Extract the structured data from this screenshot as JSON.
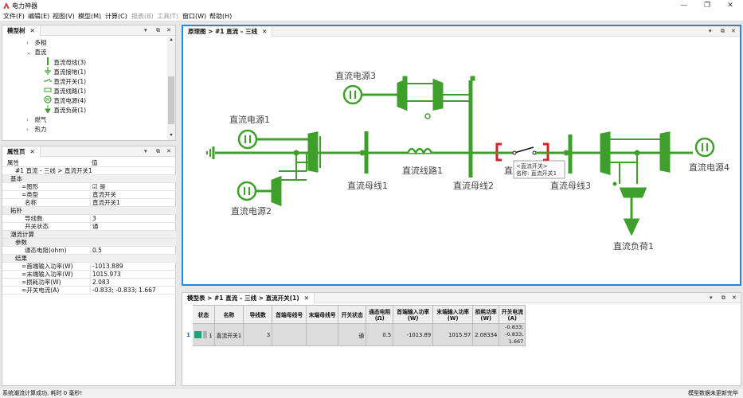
{
  "window": {
    "title": "电力神器",
    "controls": [
      "—",
      "❐",
      "✕"
    ]
  },
  "menu": [
    {
      "label": "文件(F)",
      "enabled": true
    },
    {
      "label": "编辑(E)",
      "enabled": true
    },
    {
      "label": "视图(V)",
      "enabled": true
    },
    {
      "label": "模型(M)",
      "enabled": true
    },
    {
      "label": "计算(C)",
      "enabled": true
    },
    {
      "label": "报表(B)",
      "enabled": false
    },
    {
      "label": "工具(T)",
      "enabled": false
    },
    {
      "label": "窗口(W)",
      "enabled": true
    },
    {
      "label": "帮助(H)",
      "enabled": true
    }
  ],
  "model_tree": {
    "tab": "模型树",
    "items": [
      {
        "label": "多相",
        "arrow": "›"
      },
      {
        "label": "直流",
        "arrow": "⌄"
      },
      {
        "label": "直流母线(3)"
      },
      {
        "label": "直流接地(1)"
      },
      {
        "label": "直流开关(1)"
      },
      {
        "label": "直流线路(1)"
      },
      {
        "label": "直流电源(4)"
      },
      {
        "label": "直流负荷(1)"
      },
      {
        "label": "燃气",
        "arrow": "›"
      },
      {
        "label": "热力",
        "arrow": "›"
      }
    ]
  },
  "property_page": {
    "tab": "属性页",
    "header_key": "属性",
    "header_value": "值",
    "path": "#1 直流 - 三线 > 直流开关1",
    "rows": [
      {
        "key": "基本",
        "cat": true
      },
      {
        "key": "=图形",
        "value": "是",
        "check": true
      },
      {
        "key": "=类型",
        "value": "直流开关"
      },
      {
        "key": "名称",
        "value": "直流开关1"
      },
      {
        "key": "拓扑",
        "cat": true
      },
      {
        "key": "导线数",
        "value": "3"
      },
      {
        "key": "开关状态",
        "value": "通"
      },
      {
        "key": "潮流计算",
        "cat": true
      },
      {
        "key": "参数",
        "cat": true,
        "sub": true
      },
      {
        "key": "通态电阻(ohm)",
        "value": "0.5"
      },
      {
        "key": "结果",
        "cat": true,
        "sub": true
      },
      {
        "key": "=首端输入功率(W)",
        "value": "-1013.889"
      },
      {
        "key": "=末端输入功率(W)",
        "value": "1015.973"
      },
      {
        "key": "=损耗功率(W)",
        "value": "2.083"
      },
      {
        "key": "=开关电流(A)",
        "value": "-0.833; -0.833; 1.667"
      }
    ]
  },
  "diagram": {
    "tab": "原理图 > #1 直流 – 三线",
    "labels": {
      "src1": "直流电源1",
      "src2": "直流电源2",
      "src3": "直流电源3",
      "src4": "直流电源4",
      "bus1": "直流母线1",
      "bus2": "直流母线2",
      "bus3": "直流母线3",
      "line1": "直流线路1",
      "load1": "直流负荷1",
      "partial": "直"
    },
    "tooltip": [
      "<直流开关>",
      "名称: 直流开关1"
    ],
    "colors": {
      "element": "#3ea02a",
      "selected": "#e02020",
      "accent": "#1e88e5"
    }
  },
  "model_table": {
    "tab": "模型表 > #1 直流 – 三线 > 直流开关(1)",
    "columns": [
      "状态",
      "名称",
      "导线数",
      "首端母线号",
      "末端母线号",
      "开关状态",
      "通态电阻(Ω)",
      "首端输入功率(W)",
      "末端输入功率(W)",
      "损耗功率(W)",
      "开关电流(A)"
    ],
    "rows": [
      {
        "row_no": "1",
        "status_no": "1",
        "name": "直流开关1",
        "wires": "3",
        "from_bus": "",
        "to_bus": "",
        "state": "通",
        "resistance": "0.5",
        "p_in": "-1013.89",
        "p_out": "1015.97",
        "p_loss": "2.08334",
        "current": "-0.833; -0.833; 1.667"
      }
    ]
  },
  "statusbar": {
    "left": "系统潮流计算成功, 耗时 0 毫秒!",
    "right": "模型数据未更新完毕"
  }
}
